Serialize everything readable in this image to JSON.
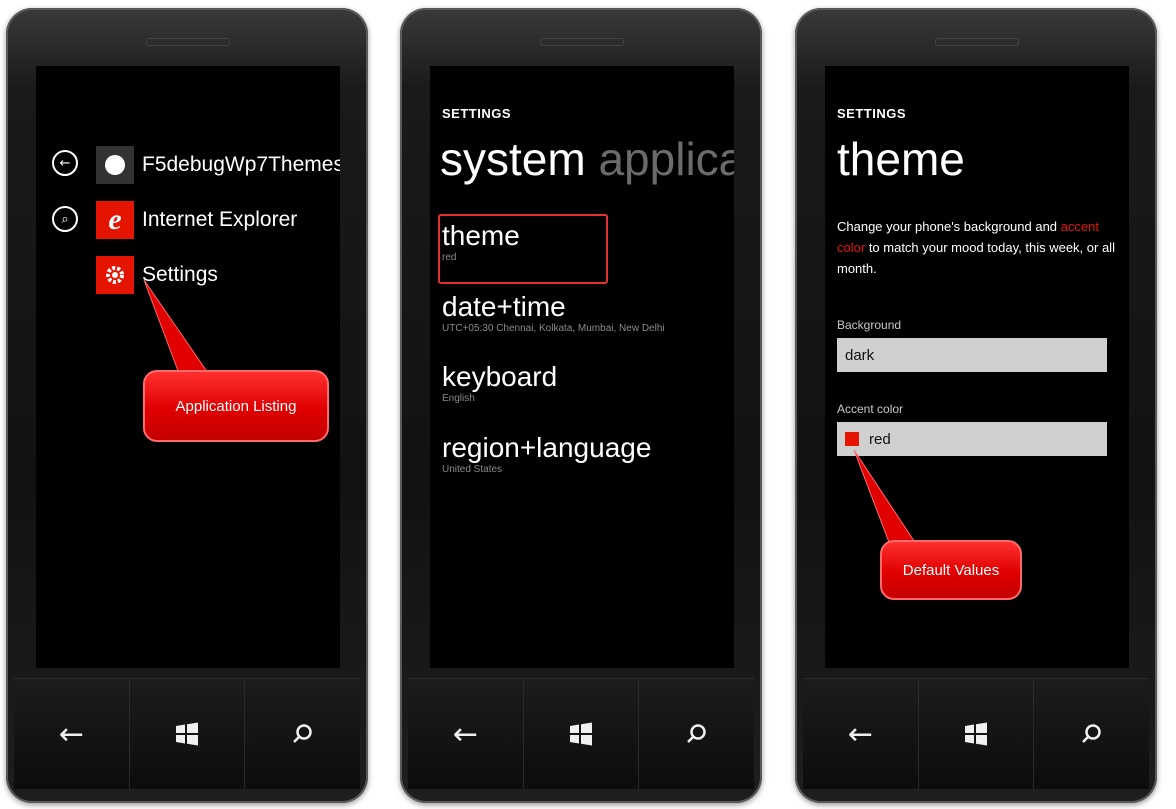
{
  "phone1": {
    "apps": [
      {
        "label": "F5debugWp7Themes",
        "icon": "app-gear-icon"
      },
      {
        "label": "Internet Explorer",
        "icon": "ie-icon"
      },
      {
        "label": "Settings",
        "icon": "settings-gear-icon"
      }
    ],
    "callout": "Application Listing"
  },
  "phone2": {
    "header": "SETTINGS",
    "pivot_active": "system",
    "pivot_inactive": "applica",
    "items": [
      {
        "title": "theme",
        "subtitle": "red"
      },
      {
        "title": "date+time",
        "subtitle": "UTC+05:30 Chennai, Kolkata, Mumbai, New Delhi"
      },
      {
        "title": "keyboard",
        "subtitle": "English"
      },
      {
        "title": "region+language",
        "subtitle": "United States"
      }
    ]
  },
  "phone3": {
    "header": "SETTINGS",
    "title": "theme",
    "desc_part1": "Change your phone's background and",
    "desc_accent": "accent color",
    "desc_part2": "to match your mood today, this week, or all month.",
    "background_label": "Background",
    "background_value": "dark",
    "accent_label": "Accent color",
    "accent_value": "red",
    "callout": "Default Values"
  },
  "hardware_buttons": [
    "back-icon",
    "windows-start-icon",
    "search-icon"
  ],
  "colors": {
    "accent": "#e51400",
    "callout": "#e00000"
  }
}
